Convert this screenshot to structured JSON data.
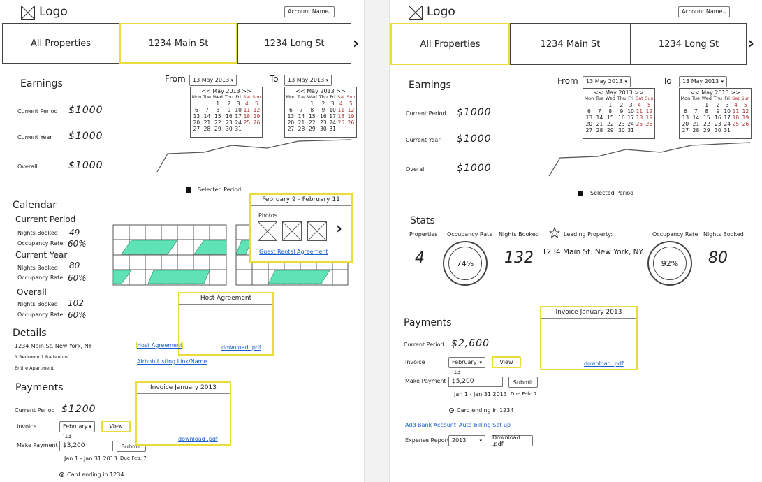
{
  "header": {
    "logo_text": "Logo",
    "account_select": "Account Name"
  },
  "left": {
    "tabs": [
      "All Properties",
      "1234 Main St",
      "1234 Long St"
    ],
    "earnings": {
      "title": "Earnings",
      "rows": [
        {
          "label": "Current Period",
          "value": "$1000"
        },
        {
          "label": "Current Year",
          "value": "$1000"
        },
        {
          "label": "Overall",
          "value": "$1000"
        }
      ]
    },
    "from_label": "From",
    "to_label": "To",
    "from_date": "13 May 2013",
    "to_date": "13 May 2013",
    "selected_period": "Selected Period",
    "calendar_section": {
      "title": "Calendar",
      "groups": [
        {
          "title": "Current Period",
          "nights_label": "Nights Booked",
          "nights": "49",
          "occ_label": "Occupancy Rate",
          "occ": "60%"
        },
        {
          "title": "Current Year",
          "nights_label": "Nights Booked",
          "nights": "80",
          "occ_label": "Occupancy Rate",
          "occ": "60%"
        },
        {
          "title": "Overall",
          "nights_label": "Nights Booked",
          "nights": "102",
          "occ_label": "Occupancy Rate",
          "occ": "60%"
        }
      ]
    },
    "booking_popup": {
      "title": "February 9 - February 11",
      "photos_label": "Photos",
      "link": "Guest Rental Agreement"
    },
    "host_popup": {
      "title": "Host Agreement",
      "link": "download .pdf"
    },
    "details": {
      "title": "Details",
      "address": "1234 Main St. New York, NY",
      "rooms": "1 Bedroom 1 Bathroom",
      "type": "Entire Apartment",
      "host_link": "Host Agreement",
      "listing_link": "Airbnb Listing Link/Name"
    },
    "payments": {
      "title": "Payments",
      "current_label": "Current Period",
      "current_value": "$1200",
      "invoice_label": "Invoice",
      "invoice_select": "February '13",
      "view_button": "View",
      "make_label": "Make Payment",
      "amount": "$3,200",
      "submit_button": "Submit",
      "range": "Jan 1 - Jan 31 2013",
      "due": "Due Feb. 7",
      "card": "Card ending in 1234"
    },
    "invoice_popup": {
      "title": "Invoice January 2013",
      "link": "download .pdf"
    }
  },
  "right": {
    "tabs": [
      "All Properties",
      "1234 Main St",
      "1234 Long St"
    ],
    "earnings": {
      "title": "Earnings",
      "rows": [
        {
          "label": "Current Period",
          "value": "$1000"
        },
        {
          "label": "Current Year",
          "value": "$1000"
        },
        {
          "label": "Overall",
          "value": "$1000"
        }
      ]
    },
    "from_label": "From",
    "to_label": "To",
    "from_date": "13 May 2013",
    "to_date": "13 May 2013",
    "selected_period": "Selected Period",
    "stats": {
      "title": "Stats",
      "properties_label": "Properties",
      "properties_value": "4",
      "occ_label": "Occupancy Rate",
      "occ_value": "74%",
      "nights_label": "Nights Booked",
      "nights_value": "132",
      "leading_label": "Leading Property:",
      "leading_address": "1234 Main St. New York, NY",
      "occ2_label": "Occupancy Rate",
      "occ2_value": "92%",
      "nights2_label": "Nights Booked",
      "nights2_value": "80"
    },
    "payments": {
      "title": "Payments",
      "current_label": "Current Period",
      "current_value": "$2,600",
      "invoice_label": "Invoice",
      "invoice_select": "February '13",
      "view_button": "View",
      "make_label": "Make Payment",
      "amount": "$5,200",
      "submit_button": "Submit",
      "range": "Jan 1 - Jan 31 2013",
      "due": "Due Feb. 7",
      "card": "Card ending in 1234",
      "add_bank": "Add Bank Account",
      "autobilling": "Auto-billing Set up",
      "expense_label": "Expense Report",
      "expense_year": "2013",
      "expense_button": "Download .pdf"
    },
    "invoice_popup": {
      "title": "Invoice January 2013",
      "link": "download .pdf"
    }
  },
  "calendar_widget": {
    "month": "<< May 2013 >>",
    "days": [
      "Mon",
      "Tue",
      "Wed",
      "Thu",
      "Fri",
      "Sat",
      "Sun"
    ],
    "weeks": [
      [
        "",
        "",
        "1",
        "2",
        "3",
        "4",
        "5"
      ],
      [
        "6",
        "7",
        "8",
        "9",
        "10",
        "11",
        "12"
      ],
      [
        "13",
        "14",
        "15",
        "16",
        "17",
        "18",
        "19"
      ],
      [
        "20",
        "21",
        "22",
        "23",
        "24",
        "25",
        "26"
      ],
      [
        "27",
        "28",
        "29",
        "30",
        "31",
        "",
        ""
      ]
    ]
  },
  "colors": {
    "highlight": "#eadc3a",
    "booking_fill": "#5fe3b6",
    "link": "#1a5fd0",
    "weekend": "#b03030"
  }
}
